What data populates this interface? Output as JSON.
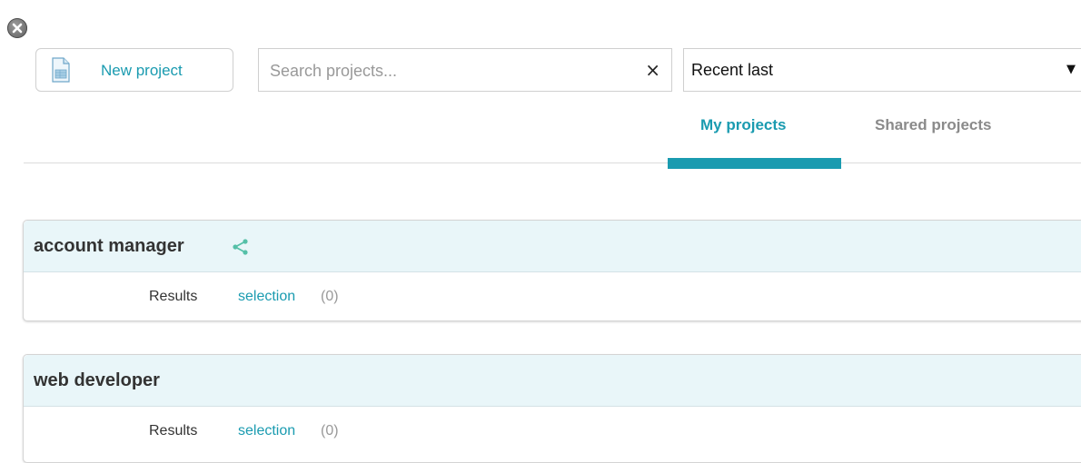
{
  "toolbar": {
    "new_project_label": "New project",
    "search_placeholder": "Search projects...",
    "search_value": "",
    "clear_symbol": "×",
    "sort_selected": "Recent last",
    "sort_arrow": "▼"
  },
  "tabs": [
    {
      "label": "My projects",
      "active": true
    },
    {
      "label": "Shared projects",
      "active": false
    }
  ],
  "projects": [
    {
      "title": "account manager",
      "shared": true,
      "results_label": "Results",
      "selection_label": "selection",
      "selection_count": "(0)"
    },
    {
      "title": "web developer",
      "shared": false,
      "results_label": "Results",
      "selection_label": "selection",
      "selection_count": "(0)"
    }
  ],
  "colors": {
    "accent": "#1a9bb0",
    "card_header": "#e9f6f9",
    "inactive_tab": "#8a8a8a"
  },
  "icons": {
    "close": "close-circle-icon",
    "new_project": "document-icon",
    "share": "share-icon"
  }
}
